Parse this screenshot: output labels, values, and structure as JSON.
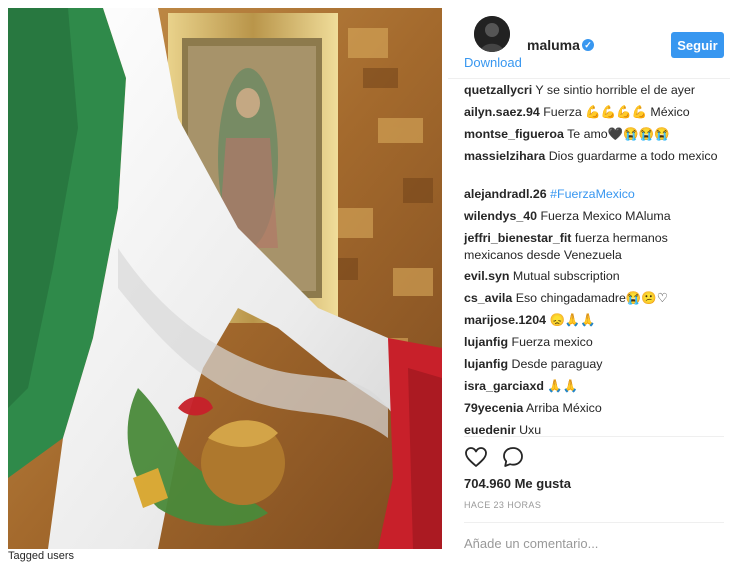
{
  "post": {
    "username": "maluma",
    "verified_mark": "✓",
    "download_link": "Download",
    "follow_button": "Seguir",
    "likes": "704.960 Me gusta",
    "time": "HACE 23 HORAS",
    "add_comment_placeholder": "Añade un comentario...",
    "below_photo_text": "Tagged users"
  },
  "comments": [
    {
      "user": "quetzallycri",
      "text": "Y se sintio horrible el de ayer"
    },
    {
      "user": "ailyn.saez.94",
      "text": "Fuerza 💪💪💪💪 México"
    },
    {
      "user": "montse_figueroa",
      "text": "Te amo🖤😭😭😭"
    },
    {
      "user": "massielzihara",
      "text": "Dios guardarme a todo mexico"
    },
    {
      "user": "alejandradl.26",
      "text": "#FuerzaMexico"
    },
    {
      "user": "wilendys_40",
      "text": "Fuerza Mexico MAluma"
    },
    {
      "user": "jeffri_bienestar_fit",
      "text": "fuerza hermanos mexicanos desde Venezuela"
    },
    {
      "user": "evil.syn",
      "text": "Mutual subscription"
    },
    {
      "user": "cs_avila",
      "text": "Eso chingadamadre😭😕♡"
    },
    {
      "user": "marijose.1204",
      "text": "😞🙏🙏"
    },
    {
      "user": "lujanfig",
      "text": "Fuerza mexico"
    },
    {
      "user": "lujanfig",
      "text": "Desde paraguay"
    },
    {
      "user": "isra_garciaxd",
      "text": "🙏🙏"
    },
    {
      "user": "79yecenia",
      "text": "Arriba México"
    },
    {
      "user": "euedenir",
      "text": "Uxu"
    }
  ],
  "icons": {
    "like": "heart-outline-icon",
    "comment": "speech-bubble-icon",
    "verified": "verified-badge-icon"
  },
  "colors": {
    "accent": "#3897f0",
    "flag_green": "#2f8a4a",
    "flag_red": "#c8202a"
  }
}
